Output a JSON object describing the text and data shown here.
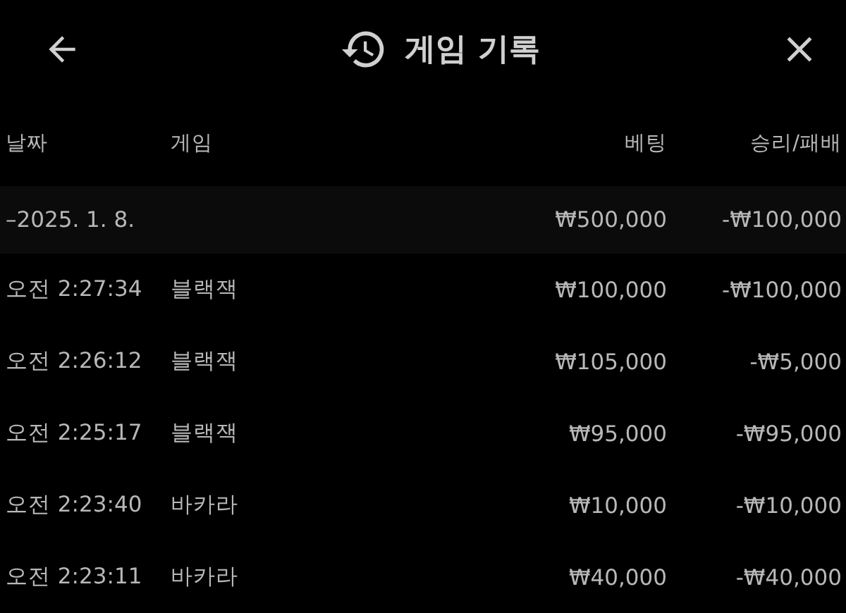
{
  "header": {
    "title": "게임 기록"
  },
  "table": {
    "columns": [
      "날짜",
      "게임",
      "베팅",
      "승리/패배"
    ],
    "group": {
      "date": "–2025. 1. 8.",
      "bet": "₩500,000",
      "result": "-₩100,000"
    },
    "rows": [
      {
        "time": "오전 2:27:34",
        "game": "블랙잭",
        "bet": "₩100,000",
        "result": "-₩100,000"
      },
      {
        "time": "오전 2:26:12",
        "game": "블랙잭",
        "bet": "₩105,000",
        "result": "-₩5,000"
      },
      {
        "time": "오전 2:25:17",
        "game": "블랙잭",
        "bet": "₩95,000",
        "result": "-₩95,000"
      },
      {
        "time": "오전 2:23:40",
        "game": "바카라",
        "bet": "₩10,000",
        "result": "-₩10,000"
      },
      {
        "time": "오전 2:23:11",
        "game": "바카라",
        "bet": "₩40,000",
        "result": "-₩40,000"
      }
    ]
  }
}
